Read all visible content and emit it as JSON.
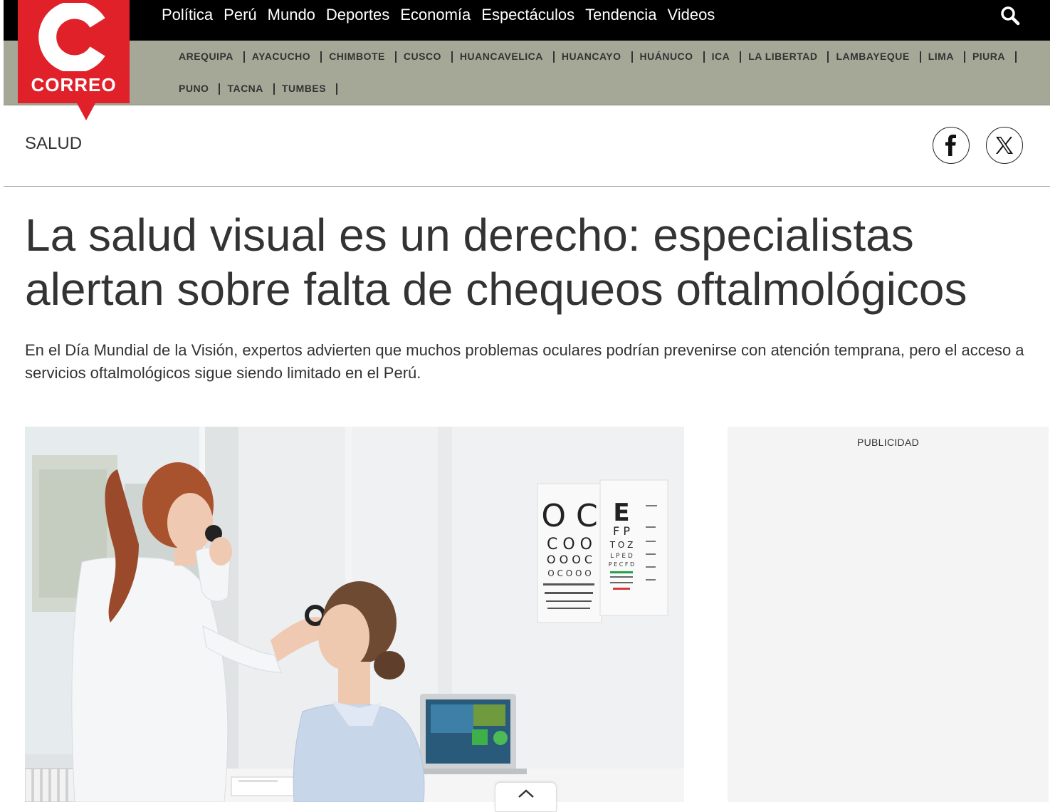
{
  "brand": {
    "name": "CORREO",
    "color": "#e1212a"
  },
  "main_nav": [
    {
      "label": "Política"
    },
    {
      "label": "Perú"
    },
    {
      "label": "Mundo"
    },
    {
      "label": "Deportes"
    },
    {
      "label": "Economía"
    },
    {
      "label": "Espectáculos"
    },
    {
      "label": "Tendencia"
    },
    {
      "label": "Videos"
    }
  ],
  "search": {
    "icon": "search-icon"
  },
  "regions": [
    {
      "label": "AREQUIPA"
    },
    {
      "label": "AYACUCHO"
    },
    {
      "label": "CHIMBOTE"
    },
    {
      "label": "CUSCO"
    },
    {
      "label": "HUANCAVELICA"
    },
    {
      "label": "HUANCAYO"
    },
    {
      "label": "HUÁNUCO"
    },
    {
      "label": "ICA"
    },
    {
      "label": "LA LIBERTAD"
    },
    {
      "label": "LAMBAYEQUE"
    },
    {
      "label": "LIMA"
    },
    {
      "label": "PIURA"
    },
    {
      "label": "PUNO"
    },
    {
      "label": "TACNA"
    },
    {
      "label": "TUMBES"
    }
  ],
  "section": {
    "label": "SALUD"
  },
  "share": [
    {
      "network": "facebook",
      "icon": "facebook-icon"
    },
    {
      "network": "x",
      "icon": "x-icon"
    }
  ],
  "article": {
    "headline": "La salud visual es un derecho: especialistas alertan sobre falta de chequeos oftalmológicos",
    "lede": "En el Día Mundial de la Visión, expertos advierten que muchos problemas oculares podrían prevenirse con atención temprana, pero el acceso a servicios oftalmológicos sigue siendo limitado en el Perú."
  },
  "eye_chart": {
    "left_rows": [
      "O C",
      "C O O",
      "O O O C",
      "O C O O O"
    ],
    "right_rows": [
      "E",
      "F P",
      "T O Z",
      "L P E D",
      "P E C F D"
    ]
  },
  "ad": {
    "label": "PUBLICIDAD"
  },
  "colors": {
    "topbar": "#000000",
    "regionbar": "#a5a797",
    "text": "#333333"
  }
}
